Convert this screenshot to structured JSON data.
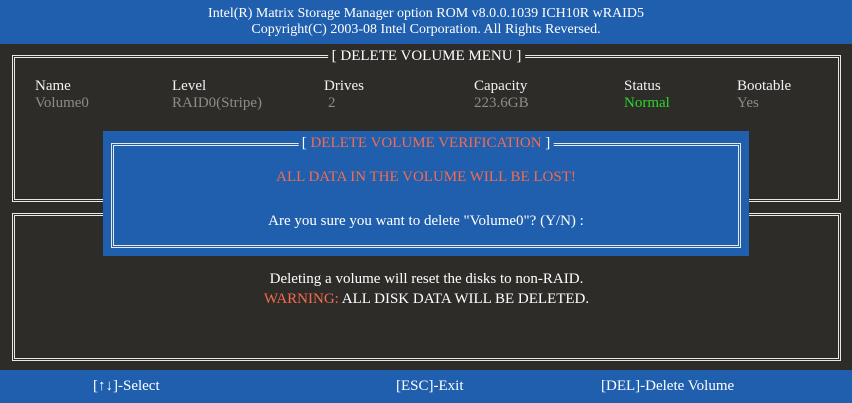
{
  "header": {
    "line1": "Intel(R) Matrix Storage Manager option ROM v8.0.0.1039 ICH10R wRAID5",
    "line2": "Copyright(C) 2003-08 Intel Corporation.  All Rights Reversed."
  },
  "volume_menu": {
    "title": "[ DELETE VOLUME MENU ]",
    "columns": [
      "Name",
      "Level",
      "Drives",
      "Capacity",
      "Status",
      "Bootable"
    ],
    "rows": [
      {
        "name": "Volume0",
        "level": "RAID0(Stripe)",
        "drives": "2",
        "capacity": "223.6GB",
        "status": "Normal",
        "bootable": "Yes"
      }
    ],
    "colors": {
      "status_normal": "#2bd62b",
      "dim_text": "#8e8c88"
    }
  },
  "dialog": {
    "title_open": "[ ",
    "title_text": "DELETE VOLUME VERIFICATION",
    "title_close": " ]",
    "warning": "ALL DATA IN THE VOLUME WILL BE LOST!",
    "question": "Are you sure you want to delete \"Volume0\"? (Y/N) :"
  },
  "info": {
    "line1": "Deleting a volume will reset the disks to non-RAID.",
    "warning_label": "WARNING:",
    "warning_text": " ALL DISK DATA WILL BE DELETED."
  },
  "footer": {
    "select": "[↑↓]-Select",
    "exit": "[ESC]-Exit",
    "delete": "[DEL]-Delete Volume"
  },
  "colors": {
    "blue": "#1f5fad",
    "background": "#2e2c29",
    "red": "#f56b4f"
  }
}
